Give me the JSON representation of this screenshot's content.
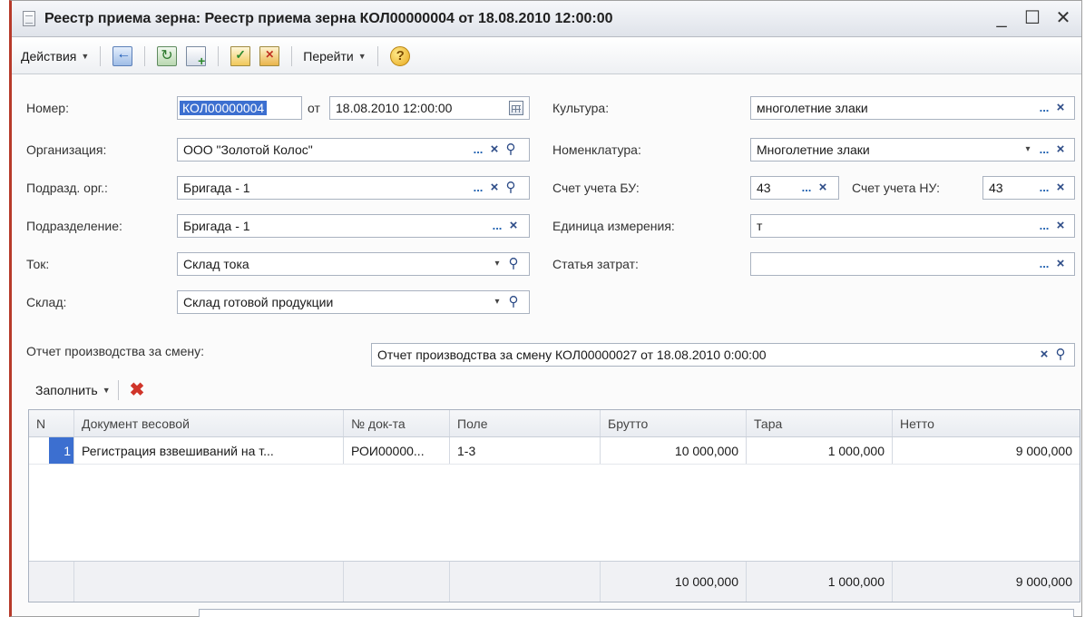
{
  "window": {
    "title": "Реестр приема зерна: Реестр приема зерна КОЛ00000004 от 18.08.2010 12:00:00",
    "minimize": "_",
    "maximize": "☐",
    "close": "✕"
  },
  "toolbar": {
    "actions_label": "Действия",
    "goto_label": "Перейти",
    "icons": [
      "exit-icon",
      "refresh-icon",
      "copy-icon",
      "post-icon",
      "unpost-icon",
      "help-icon"
    ]
  },
  "form": {
    "number": {
      "label": "Номер:",
      "value": "КОЛ00000004",
      "date_sep": "от",
      "date": "18.08.2010 12:00:00"
    },
    "organization": {
      "label": "Организация:",
      "value": "ООО \"Золотой Колос\""
    },
    "org_division": {
      "label": "Подразд. орг.:",
      "value": "Бригада - 1"
    },
    "division": {
      "label": "Подразделение:",
      "value": "Бригада - 1"
    },
    "tok": {
      "label": "Ток:",
      "value": "Склад тока"
    },
    "warehouse": {
      "label": "Склад:",
      "value": "Склад готовой продукции"
    },
    "culture": {
      "label": "Культура:",
      "value": "многолетние злаки"
    },
    "nomenclature": {
      "label": "Номенклатура:",
      "value": "Многолетние злаки"
    },
    "account_bu": {
      "label": "Счет учета БУ:",
      "value": "43"
    },
    "account_nu": {
      "label": "Счет учета НУ:",
      "value": "43"
    },
    "unit": {
      "label": "Единица измерения:",
      "value": "т"
    },
    "cost_item": {
      "label": "Статья затрат:",
      "value": ""
    },
    "shift_report": {
      "label": "Отчет производства  за смену:",
      "value": "Отчет производства за смену КОЛ00000027 от 18.08.2010 0:00:00"
    }
  },
  "buttons": {
    "dots": "...",
    "clear": "×",
    "dropdown": "▾",
    "search": "⚲"
  },
  "fill": {
    "label": "Заполнить",
    "delete_icon": "✖"
  },
  "table": {
    "headers": [
      "N",
      "Документ весовой",
      "№ док-та",
      "Поле",
      "Брутто",
      "Тара",
      "Нетто"
    ],
    "rows": [
      {
        "n": "1",
        "doc": "Регистрация взвешиваний на т...",
        "num": "РОИ00000...",
        "field": "1-3",
        "gross": "10 000,000",
        "tare": "1 000,000",
        "net": "9 000,000"
      }
    ],
    "totals": {
      "gross": "10 000,000",
      "tare": "1 000,000",
      "net": "9 000,000"
    }
  }
}
